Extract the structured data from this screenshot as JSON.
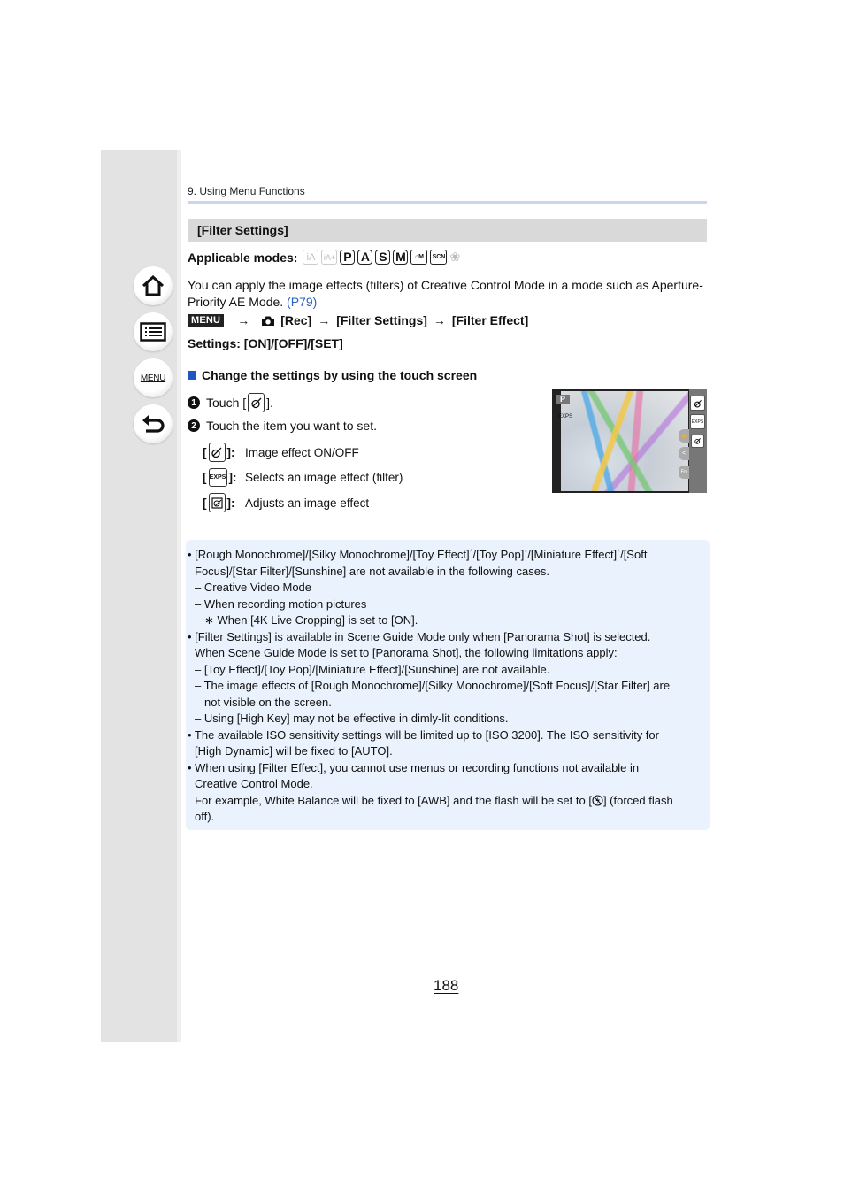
{
  "sidebar": {
    "buttons": [
      {
        "name": "home",
        "icon": "home-icon"
      },
      {
        "name": "contents",
        "icon": "list-icon"
      },
      {
        "name": "menu",
        "icon": "menu-icon",
        "label": "MENU"
      },
      {
        "name": "back",
        "icon": "back-arrow-icon"
      }
    ]
  },
  "header": {
    "breadcrumb": "9. Using Menu Functions"
  },
  "section": {
    "title": "[Filter Settings]"
  },
  "applicable_modes": {
    "label": "Applicable modes:",
    "modes": [
      {
        "label": "iA",
        "enabled": false
      },
      {
        "label": "iA+",
        "enabled": false
      },
      {
        "label": "P",
        "enabled": true
      },
      {
        "label": "A",
        "enabled": true
      },
      {
        "label": "S",
        "enabled": true
      },
      {
        "label": "M",
        "enabled": true
      },
      {
        "label": "⌂M",
        "enabled": true
      },
      {
        "label": "SCN",
        "enabled": true
      },
      {
        "label": "❀",
        "enabled": false
      }
    ]
  },
  "intro": {
    "text": "You can apply the image effects (filters) of Creative Control Mode in a mode such as Aperture-Priority AE Mode.",
    "link": "(P79)"
  },
  "menu_path": {
    "menu_badge": "MENU",
    "arrow": "→",
    "items": [
      "[Rec]",
      "[Filter Settings]",
      "[Filter Effect]"
    ]
  },
  "settings": "Settings: [ON]/[OFF]/[SET]",
  "touch_section": {
    "heading": "Change the settings by using the touch screen",
    "steps": [
      {
        "num": "1",
        "before": "Touch [",
        "after": "]."
      },
      {
        "num": "2",
        "text": "Touch the item you want to set."
      }
    ],
    "definitions": [
      {
        "icon": "image-effect-icon",
        "desc": "Image effect ON/OFF"
      },
      {
        "icon": "exps-icon",
        "icon_text": "EXPS",
        "desc": "Selects an image effect (filter)"
      },
      {
        "icon": "adjust-effect-icon",
        "desc": "Adjusts an image effect"
      }
    ]
  },
  "screen_preview": {
    "mode_badge": "P",
    "exps_label": "EXPS",
    "rail_buttons": [
      "effect",
      "EXPS",
      "adjust"
    ],
    "tab_labels": [
      "",
      "<",
      "Fn"
    ]
  },
  "notes": {
    "lines": [
      {
        "indent": 0,
        "bullet": "• ",
        "text": "[Rough Monochrome]/[Silky Monochrome]/[Toy Effect]",
        "ast": [
          "*",
          "/[Toy Pop]",
          "*",
          "/[Miniature Effect]",
          "*",
          "/[Soft"
        ]
      },
      {
        "indent": 1,
        "text": "Focus]/[Star Filter]/[Sunshine] are not available in the following cases."
      },
      {
        "indent": 1,
        "text": "– Creative Video Mode"
      },
      {
        "indent": 1,
        "text": "– When recording motion pictures"
      },
      {
        "indent": 2,
        "text": "∗ When [4K Live Cropping] is set to [ON]."
      },
      {
        "indent": 0,
        "text": "• [Filter Settings] is available in Scene Guide Mode only when [Panorama Shot] is selected."
      },
      {
        "indent": 1,
        "text": "When Scene Guide Mode is set to [Panorama Shot], the following limitations apply:"
      },
      {
        "indent": 1,
        "text": "– [Toy Effect]/[Toy Pop]/[Miniature Effect]/[Sunshine] are not available."
      },
      {
        "indent": 1,
        "text": "– The image effects of [Rough Monochrome]/[Silky Monochrome]/[Soft Focus]/[Star Filter] are"
      },
      {
        "indent": 2,
        "text": "not visible on the screen."
      },
      {
        "indent": 1,
        "text": "– Using [High Key] may not be effective in dimly-lit conditions."
      },
      {
        "indent": 0,
        "text": "• The available ISO sensitivity settings will be limited up to [ISO 3200]. The ISO sensitivity for"
      },
      {
        "indent": 1,
        "text": "[High Dynamic] will be fixed to [AUTO]."
      },
      {
        "indent": 0,
        "text": "• When using [Filter Effect], you cannot use menus or recording functions not available in"
      },
      {
        "indent": 1,
        "text": "Creative Control Mode."
      },
      {
        "indent": 1,
        "text": "For example, White Balance will be fixed to [AWB] and the flash will be set to [",
        "icon": "flash-off-icon",
        "after": "] (forced flash"
      },
      {
        "indent": 1,
        "text": "off)."
      }
    ]
  },
  "page_number": "188"
}
